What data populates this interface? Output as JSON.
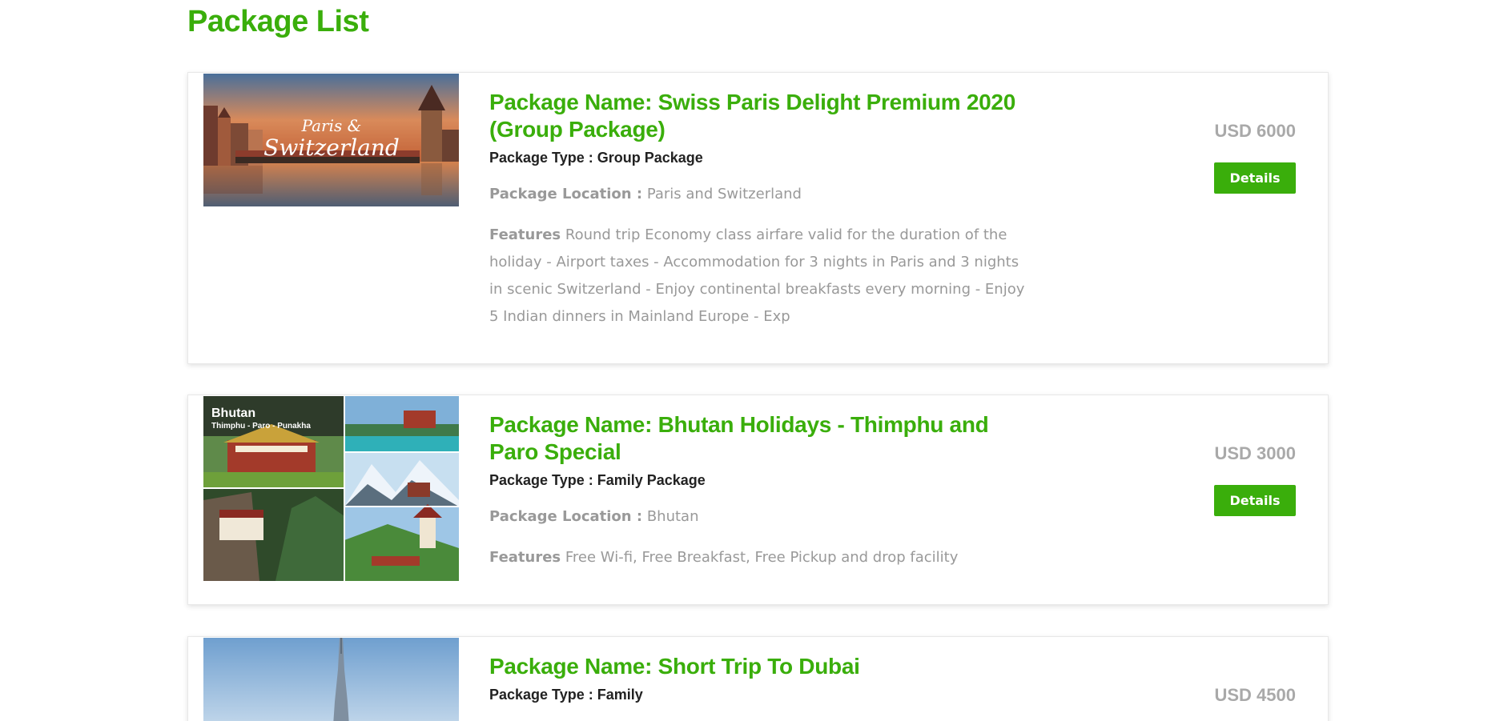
{
  "page": {
    "title": "Package List"
  },
  "colors": {
    "accent": "#3aae0b",
    "price": "#a9a9a9",
    "muted": "#999999"
  },
  "packages": [
    {
      "name": "Package Name: Swiss Paris Delight Premium 2020 (Group Package)",
      "type": "Package Type : Group Package",
      "location_label": "Package Location :",
      "location": "Paris and Switzerland",
      "features_label": "Features",
      "features": "Round trip Economy class airfare valid for the duration of the holiday - Airport taxes - Accommodation for 3 nights in Paris and 3 nights in scenic Switzerland - Enjoy continental breakfasts every morning - Enjoy 5 Indian dinners in Mainland Europe - Exp",
      "price": "USD 6000",
      "button_label": "Details",
      "image_text_line1": "Paris &",
      "image_text_line2": "Switzerland"
    },
    {
      "name": "Package Name: Bhutan Holidays - Thimphu and Paro Special",
      "type": "Package Type : Family Package",
      "location_label": "Package Location :",
      "location": "Bhutan",
      "features_label": "Features",
      "features": "Free Wi-fi, Free Breakfast, Free Pickup and drop facility",
      "price": "USD 3000",
      "button_label": "Details",
      "image_text_line1": "Bhutan",
      "image_text_line2": "Thimphu - Paro - Punakha"
    },
    {
      "name": "Package Name: Short Trip To Dubai",
      "type": "Package Type : Family",
      "price": "USD 4500"
    }
  ]
}
